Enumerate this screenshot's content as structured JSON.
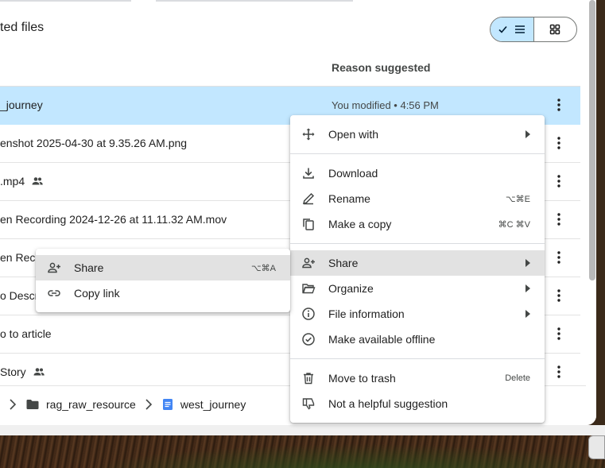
{
  "page": {
    "title": "ted files"
  },
  "view_toggle": {
    "list_active": true
  },
  "table": {
    "reason_header": "Reason suggested",
    "rows": [
      {
        "name": "_journey",
        "reason": "You modified • 4:56 PM",
        "shared": false,
        "selected": true
      },
      {
        "name": "enshot 2025-04-30 at 9.35.26 AM.png",
        "reason": "",
        "shared": false,
        "selected": false
      },
      {
        "name": ".mp4",
        "reason": "",
        "shared": true,
        "selected": false
      },
      {
        "name": "en Recording 2024-12-26 at 11.11.32 AM.mov",
        "reason": "",
        "shared": false,
        "selected": false
      },
      {
        "name": "en Reco",
        "reason": "",
        "shared": false,
        "selected": false
      },
      {
        "name": "o Descr",
        "reason": "",
        "shared": false,
        "selected": false
      },
      {
        "name": "o to article",
        "reason": "",
        "shared": false,
        "selected": false
      },
      {
        "name": "Story",
        "reason": "",
        "shared": true,
        "selected": false
      }
    ]
  },
  "breadcrumb": {
    "folder": "rag_raw_resource",
    "file": "west_journey"
  },
  "context_menu": {
    "open_with": "Open with",
    "download": "Download",
    "rename": "Rename",
    "rename_shortcut": "⌥⌘E",
    "make_copy": "Make a copy",
    "make_copy_shortcut": "⌘C ⌘V",
    "share": "Share",
    "organize": "Organize",
    "file_information": "File information",
    "make_offline": "Make available offline",
    "move_to_trash": "Move to trash",
    "move_to_trash_shortcut": "Delete",
    "not_helpful": "Not a helpful suggestion"
  },
  "share_submenu": {
    "share": "Share",
    "share_shortcut": "⌥⌘A",
    "copy_link": "Copy link"
  },
  "colors": {
    "selected_row": "#c2e7ff",
    "doc_blue": "#4285f4",
    "menu_hover": "#e2e2e2"
  }
}
